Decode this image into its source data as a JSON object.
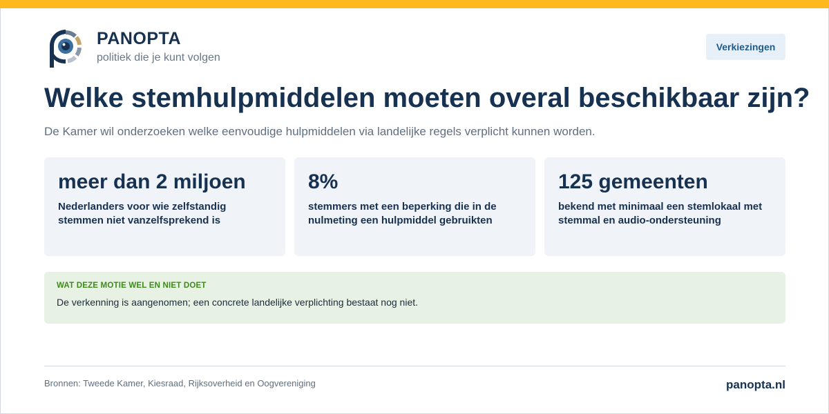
{
  "colors": {
    "accent_bar": "#fdb91e",
    "primary_text": "#173150",
    "muted_text": "#68778a",
    "card_bg": "#f0f3f7",
    "notice_bg": "#e7f2e4",
    "notice_heading": "#3e8a1b",
    "nav_button_bg": "#e7f0f8",
    "nav_button_text": "#1e5b8c"
  },
  "header": {
    "logo_icon": "panopta-eye-logo-icon",
    "brand_name": "PANOPTA",
    "tagline": "politiek die je kunt volgen",
    "nav_button_label": "Verkiezingen"
  },
  "main": {
    "title": "Welke stemhulpmiddelen moeten overal beschikbaar zijn?",
    "subtitle": "De Kamer wil onderzoeken welke eenvoudige hulpmiddelen via landelijke regels verplicht kunnen worden.",
    "stats": [
      {
        "value": "meer dan 2 miljoen",
        "description": "Nederlanders voor wie zelfstandig stemmen niet vanzelfsprekend is"
      },
      {
        "value": "8%",
        "description": "stemmers met een beperking die in de nulmeting een hulpmiddel gebruikten"
      },
      {
        "value": "125 gemeenten",
        "description": "bekend met minimaal een stemlokaal met stemmal en audio-ondersteuning"
      }
    ],
    "notice": {
      "heading": "WAT DEZE MOTIE WEL EN NIET DOET",
      "text": "De verkenning is aangenomen; een concrete landelijke verplichting bestaat nog niet."
    }
  },
  "footer": {
    "sources": "Bronnen: Tweede Kamer, Kiesraad, Rijksoverheid en Oogvereniging",
    "domain": "panopta.nl"
  }
}
